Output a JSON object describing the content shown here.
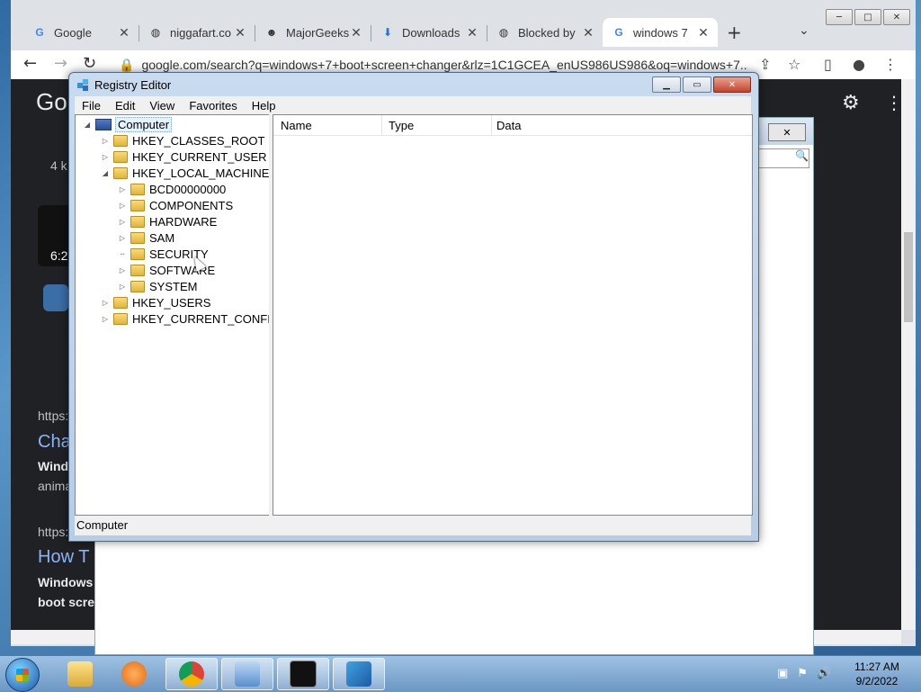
{
  "chrome": {
    "tabs": [
      {
        "label": "Google",
        "icon": "google-icon"
      },
      {
        "label": "niggafart.co",
        "icon": "globe-icon"
      },
      {
        "label": "MajorGeeks",
        "icon": "majorgeeks-icon"
      },
      {
        "label": "Downloads",
        "icon": "download-icon"
      },
      {
        "label": "Blocked by",
        "icon": "globe-icon"
      },
      {
        "label": "windows 7",
        "icon": "google-icon"
      }
    ],
    "new_tab": "+",
    "url": "google.com/search?q=windows+7+boot+screen+changer&rlz=1C1GCEA_enUS986US986&oq=windows+7...",
    "win_min": "─",
    "win_max": "□",
    "win_close": "✕"
  },
  "page": {
    "logo": "Go",
    "snip1": "4 k",
    "snip2": "6:2",
    "snip3": "https:",
    "title1": "Cha",
    "snip4": "Wind",
    "snip5": "anima",
    "snip6": "https:",
    "title2": "How T",
    "snip7": "Windows",
    "snip8": "boot scre"
  },
  "regedit": {
    "title": "Registry Editor",
    "menu": [
      "File",
      "Edit",
      "View",
      "Favorites",
      "Help"
    ],
    "tree": {
      "root": "Computer",
      "hives": [
        "HKEY_CLASSES_ROOT",
        "HKEY_CURRENT_USER",
        "HKEY_LOCAL_MACHINE",
        "HKEY_USERS",
        "HKEY_CURRENT_CONFIG"
      ],
      "hklm_children": [
        "BCD00000000",
        "COMPONENTS",
        "HARDWARE",
        "SAM",
        "SECURITY",
        "SOFTWARE",
        "SYSTEM"
      ]
    },
    "columns": [
      "Name",
      "Type",
      "Data"
    ],
    "status": "Computer"
  },
  "taskbar": {
    "clock_time": "11:27 AM",
    "clock_date": "9/2/2022"
  }
}
